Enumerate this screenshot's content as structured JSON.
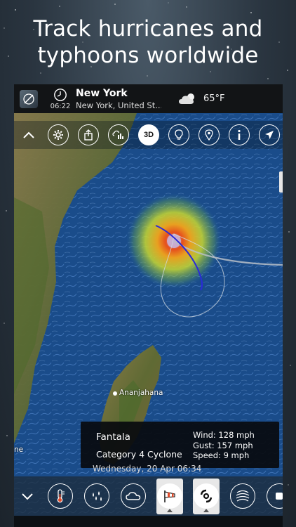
{
  "headline": {
    "line1": "Track hurricanes and",
    "line2": "typhoons worldwide"
  },
  "statusbar": {
    "time": "06:22",
    "city": "New York",
    "location_full": "New York, United St...",
    "temperature": "65°F",
    "weather_icon": "partly-cloudy-icon"
  },
  "toolbar": {
    "items": [
      {
        "name": "collapse-chevron",
        "icon": "chevron-up-icon"
      },
      {
        "name": "settings",
        "icon": "gear-icon"
      },
      {
        "name": "share",
        "icon": "share-icon"
      },
      {
        "name": "weather-stations",
        "icon": "weather-stations-icon"
      },
      {
        "name": "3d",
        "label": "3D"
      },
      {
        "name": "tips",
        "icon": "lightbulb-icon"
      },
      {
        "name": "location-pin",
        "icon": "pin-icon"
      },
      {
        "name": "info",
        "icon": "info-icon"
      },
      {
        "name": "locate",
        "icon": "navigation-arrow-icon"
      }
    ]
  },
  "map": {
    "place_label": "Ananjahana",
    "edge_label": "ne"
  },
  "storm_card": {
    "name": "Fantala",
    "category": "Category 4 Cyclone",
    "wind": "Wind: 128 mph",
    "gust": "Gust: 157 mph",
    "speed": "Speed: 9 mph"
  },
  "date_text": "Wednesday, 20 Apr 06:34",
  "bottombar": {
    "layers": [
      {
        "name": "temperature",
        "icon": "thermometer-icon",
        "selected": false
      },
      {
        "name": "precipitation",
        "icon": "raindrops-icon",
        "selected": false
      },
      {
        "name": "clouds",
        "icon": "cloud-icon",
        "selected": false
      },
      {
        "name": "wind",
        "icon": "windsock-icon",
        "selected": true
      },
      {
        "name": "hurricanes",
        "icon": "hurricane-icon",
        "selected": true
      },
      {
        "name": "waves",
        "icon": "waves-icon",
        "selected": false
      },
      {
        "name": "more",
        "icon": "more-icon",
        "selected": false
      }
    ]
  },
  "colors": {
    "ocean": "#1b4e8c",
    "land": "#7a6a3a",
    "storm_core": "#e6501e",
    "storm_ring": "#d8e040",
    "track": "#3a3aff"
  }
}
